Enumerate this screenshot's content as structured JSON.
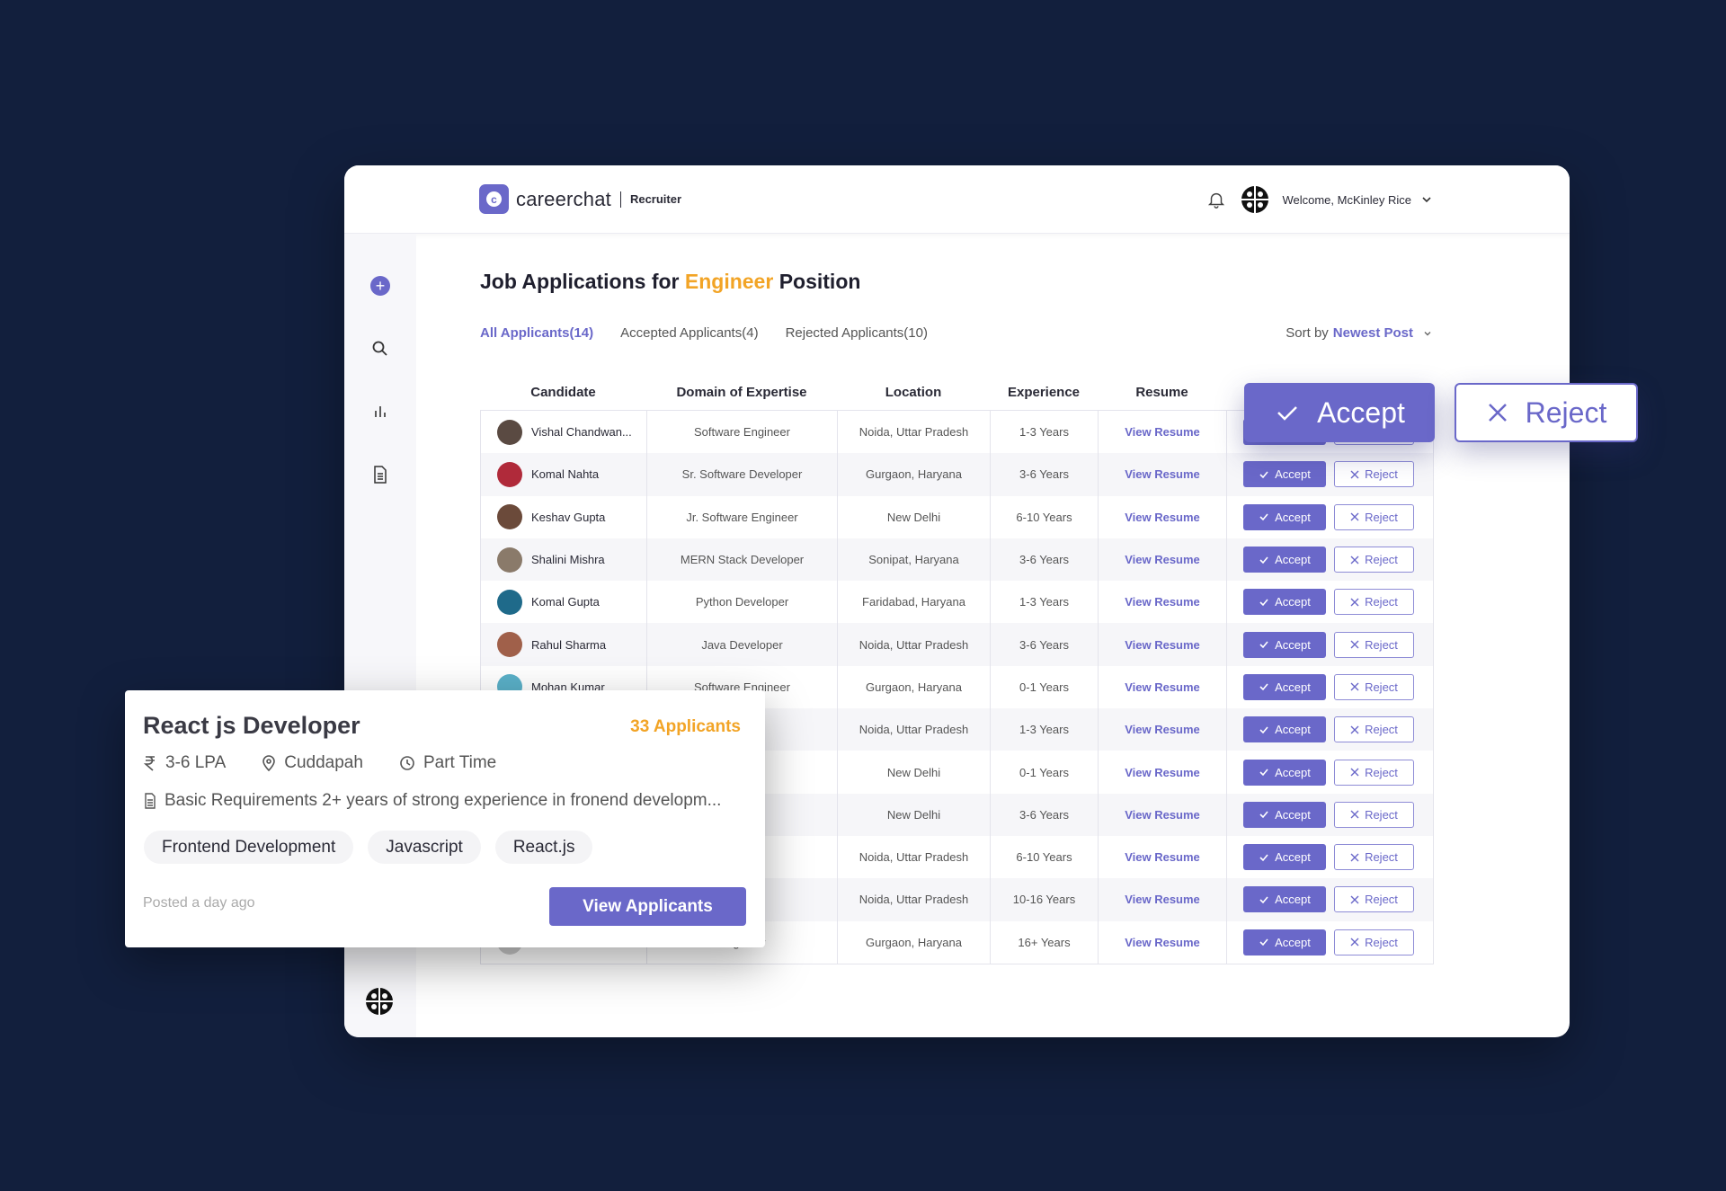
{
  "header": {
    "logo_letter": "c",
    "brand": "careerchat",
    "role": "Recruiter",
    "welcome": "Welcome, McKinley Rice"
  },
  "page": {
    "title_prefix": "Job Applications for",
    "title_accent": "Engineer",
    "title_suffix": "Position"
  },
  "tabs": [
    {
      "label": "All Applicants(14)",
      "active": true
    },
    {
      "label": "Accepted Applicants(4)",
      "active": false
    },
    {
      "label": "Rejected Applicants(10)",
      "active": false
    }
  ],
  "sort": {
    "prefix": "Sort by",
    "value": "Newest Post"
  },
  "table": {
    "headers": [
      "Candidate",
      "Domain of Expertise",
      "Location",
      "Experience",
      "Resume"
    ],
    "resume_label": "View Resume",
    "accept_label": "Accept",
    "reject_label": "Reject",
    "rows": [
      {
        "name": "Vishal Chandwan...",
        "domain": "Software Engineer",
        "location": "Noida, Uttar Pradesh",
        "experience": "1-3 Years",
        "avatar_color": "#5a4a42"
      },
      {
        "name": "Komal Nahta",
        "domain": "Sr. Software Developer",
        "location": "Gurgaon, Haryana",
        "experience": "3-6 Years",
        "avatar_color": "#b02a3a"
      },
      {
        "name": "Keshav Gupta",
        "domain": "Jr. Software Engineer",
        "location": "New Delhi",
        "experience": "6-10 Years",
        "avatar_color": "#6b4a3a"
      },
      {
        "name": "Shalini Mishra",
        "domain": "MERN Stack Developer",
        "location": "Sonipat, Haryana",
        "experience": "3-6 Years",
        "avatar_color": "#8a7a6a"
      },
      {
        "name": "Komal Gupta",
        "domain": "Python Developer",
        "location": "Faridabad, Haryana",
        "experience": "1-3 Years",
        "avatar_color": "#1f6a8a"
      },
      {
        "name": "Rahul Sharma",
        "domain": "Java Developer",
        "location": "Noida, Uttar Pradesh",
        "experience": "3-6 Years",
        "avatar_color": "#a0604a"
      },
      {
        "name": "Mohan Kumar",
        "domain": "Software Engineer",
        "location": "Gurgaon, Haryana",
        "experience": "0-1 Years",
        "avatar_color": "#5ab0c8"
      },
      {
        "name": "",
        "domain": "g Intern",
        "location": "Noida, Uttar Pradesh",
        "experience": "1-3 Years",
        "avatar_color": "#cccccc"
      },
      {
        "name": "",
        "domain": "ineer",
        "location": "New Delhi",
        "experience": "0-1 Years",
        "avatar_color": "#cccccc"
      },
      {
        "name": "",
        "domain": "oper",
        "location": "New Delhi",
        "experience": "3-6 Years",
        "avatar_color": "#cccccc"
      },
      {
        "name": "",
        "domain": "nt Intern",
        "location": "Noida, Uttar Pradesh",
        "experience": "6-10 Years",
        "avatar_color": "#cccccc"
      },
      {
        "name": "",
        "domain": "tant",
        "location": "Noida, Uttar Pradesh",
        "experience": "10-16 Years",
        "avatar_color": "#cccccc"
      },
      {
        "name": "",
        "domain": "Engineer",
        "location": "Gurgaon, Haryana",
        "experience": "16+ Years",
        "avatar_color": "#cccccc"
      }
    ]
  },
  "floating": {
    "accept": "Accept",
    "reject": "Reject"
  },
  "job_card": {
    "title": "React js Developer",
    "applicants": "33 Applicants",
    "salary": "3-6 LPA",
    "location": "Cuddapah",
    "type": "Part Time",
    "requirements": "Basic Requirements 2+ years of strong experience in fronend developm...",
    "skills": [
      "Frontend Development",
      "Javascript",
      "React.js"
    ],
    "posted": "Posted a day ago",
    "cta": "View Applicants"
  },
  "colors": {
    "primary": "#6a68c9",
    "accent": "#f2a426",
    "background": "#121f3d"
  }
}
